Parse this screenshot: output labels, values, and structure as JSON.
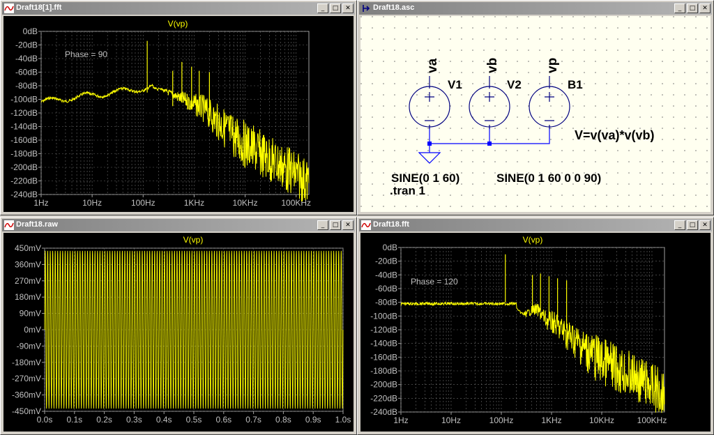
{
  "windows": {
    "fft1": {
      "title": "Draft18[1].fft",
      "trace": "V(vp)",
      "annotation": "Phase = 90",
      "y_ticks": [
        "0dB",
        "-20dB",
        "-40dB",
        "-60dB",
        "-80dB",
        "-100dB",
        "-120dB",
        "-140dB",
        "-160dB",
        "-180dB",
        "-200dB",
        "-220dB",
        "-240dB"
      ],
      "x_ticks": [
        "1Hz",
        "10Hz",
        "100Hz",
        "1KHz",
        "10KHz",
        "100KHz"
      ]
    },
    "schematic": {
      "title": "Draft18.asc",
      "sources": [
        {
          "name": "V1",
          "net": "va",
          "value": "SINE(0 1 60)"
        },
        {
          "name": "V2",
          "net": "vb",
          "value": "SINE(0 1 60 0 0 90)"
        },
        {
          "name": "B1",
          "net": "vp",
          "value": "V=v(va)*v(vb)"
        }
      ],
      "directive": ".tran 1"
    },
    "raw": {
      "title": "Draft18.raw",
      "trace": "V(vp)",
      "y_ticks": [
        "450mV",
        "360mV",
        "270mV",
        "180mV",
        "90mV",
        "0mV",
        "-90mV",
        "-180mV",
        "-270mV",
        "-360mV",
        "-450mV"
      ],
      "x_ticks": [
        "0.0s",
        "0.1s",
        "0.2s",
        "0.3s",
        "0.4s",
        "0.5s",
        "0.6s",
        "0.7s",
        "0.8s",
        "0.9s",
        "1.0s"
      ]
    },
    "fft2": {
      "title": "Draft18.fft",
      "trace": "V(vp)",
      "annotation": "Phase = 120",
      "y_ticks": [
        "0dB",
        "-20dB",
        "-40dB",
        "-60dB",
        "-80dB",
        "-100dB",
        "-120dB",
        "-140dB",
        "-160dB",
        "-180dB",
        "-200dB",
        "-220dB",
        "-240dB"
      ],
      "x_ticks": [
        "1Hz",
        "10Hz",
        "100Hz",
        "1KHz",
        "10KHz",
        "100KHz"
      ]
    }
  },
  "title_buttons": {
    "minimize": "_",
    "maximize": "□",
    "close": "✕"
  },
  "colors": {
    "trace": "#ffff00",
    "axes_text": "#c0c0c0",
    "wire": "#0000ff",
    "component": "#000080"
  }
}
